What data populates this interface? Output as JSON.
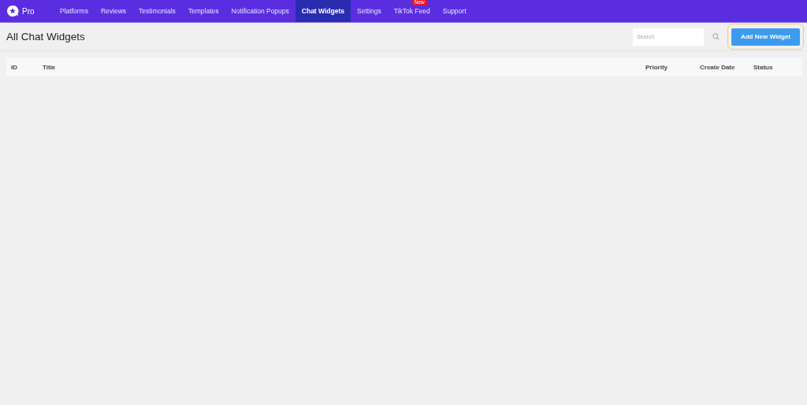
{
  "nav": {
    "brand": "Pro",
    "items": [
      {
        "label": "Platforms",
        "selected": false
      },
      {
        "label": "Reviews",
        "selected": false
      },
      {
        "label": "Testimonials",
        "selected": false
      },
      {
        "label": "Templates",
        "selected": false
      },
      {
        "label": "Notification Popups",
        "selected": false
      },
      {
        "label": "Chat Widgets",
        "selected": true
      },
      {
        "label": "Settings",
        "selected": false
      },
      {
        "label": "TikTok Feed",
        "selected": false,
        "badge": "New"
      },
      {
        "label": "Support",
        "selected": false
      }
    ]
  },
  "page_title": "All Chat Widgets",
  "search": {
    "placeholder": "Search"
  },
  "add_button": {
    "label": "Add New Widget",
    "highlighted": true
  },
  "table": {
    "columns": [
      "ID",
      "Title",
      "Priority",
      "Create Date",
      "Status"
    ]
  }
}
